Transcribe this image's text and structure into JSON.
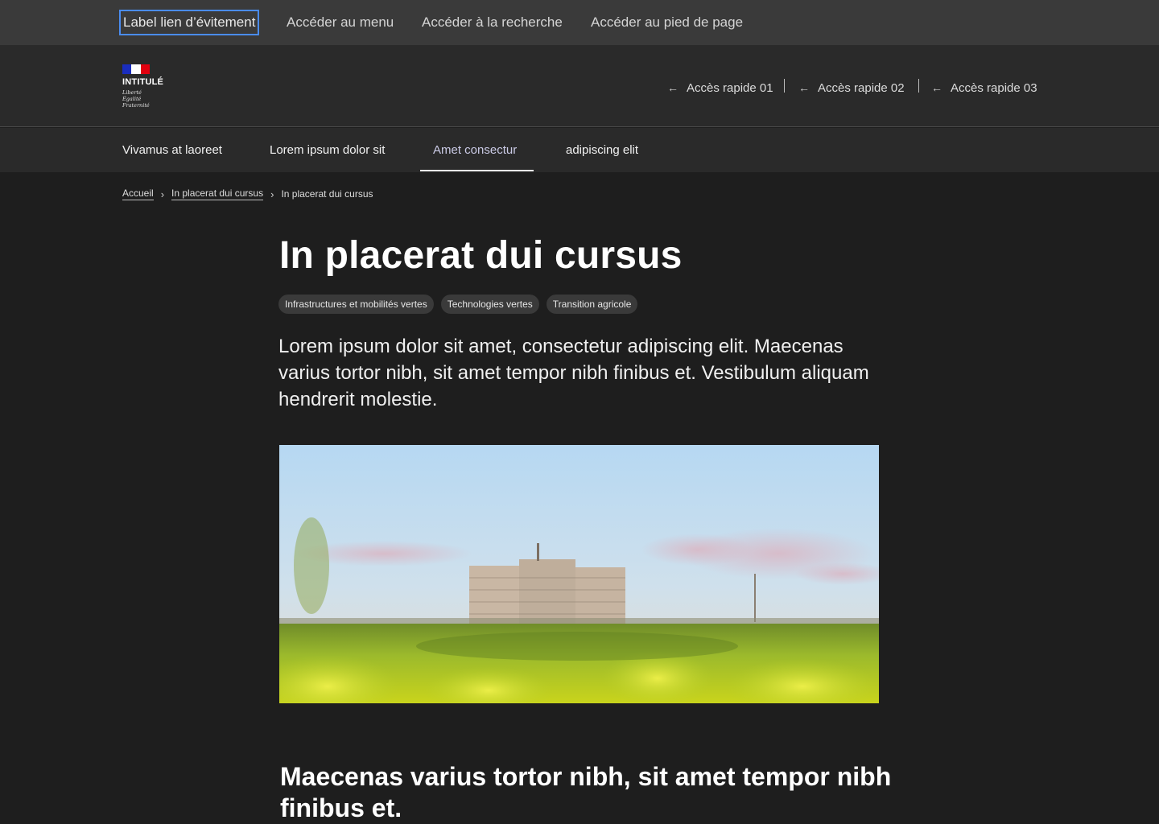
{
  "skiplinks": [
    {
      "label": "Label lien d’évitement"
    },
    {
      "label": "Accéder au menu"
    },
    {
      "label": "Accéder à la recherche"
    },
    {
      "label": "Accéder au pied de page"
    }
  ],
  "header": {
    "logo": {
      "title": "INTITULÉ",
      "motto": [
        "Liberté",
        "Égalité",
        "Fraternité"
      ]
    },
    "quick_access": [
      {
        "label": "Accès rapide 01",
        "icon": "arrow-left-icon"
      },
      {
        "label": "Accès rapide 02",
        "icon": "arrow-left-icon"
      },
      {
        "label": "Accès rapide 03",
        "icon": "arrow-left-icon"
      }
    ]
  },
  "nav": {
    "items": [
      {
        "label": "Vivamus at laoreet"
      },
      {
        "label": "Lorem ipsum dolor sit"
      },
      {
        "label": "Amet consectur",
        "active": true
      },
      {
        "label": "adipiscing elit"
      }
    ]
  },
  "breadcrumb": {
    "items": [
      "Accueil",
      "In placerat dui cursus",
      "In placerat dui cursus"
    ]
  },
  "content": {
    "title": "In placerat dui cursus",
    "tags": [
      "Infrastructures et mobilités vertes",
      "Technologies vertes",
      "Transition agricole"
    ],
    "lead": "Lorem ipsum dolor sit amet, consectetur adipiscing elit. Maecenas varius tortor nibh, sit amet tempor nibh finibus et. Vestibulum aliquam hendrerit molestie.",
    "subheading": "Maecenas varius tortor nibh, sit amet tempor nibh finibus et."
  },
  "colors": {
    "page_bg": "#1e1e1e",
    "skiplinks_bg": "#3a3a3a",
    "header_bg": "#2a2a2a",
    "focus_outline": "#4a8cf0",
    "flag_blue": "#1a2dbd",
    "flag_red": "#e1000f"
  }
}
